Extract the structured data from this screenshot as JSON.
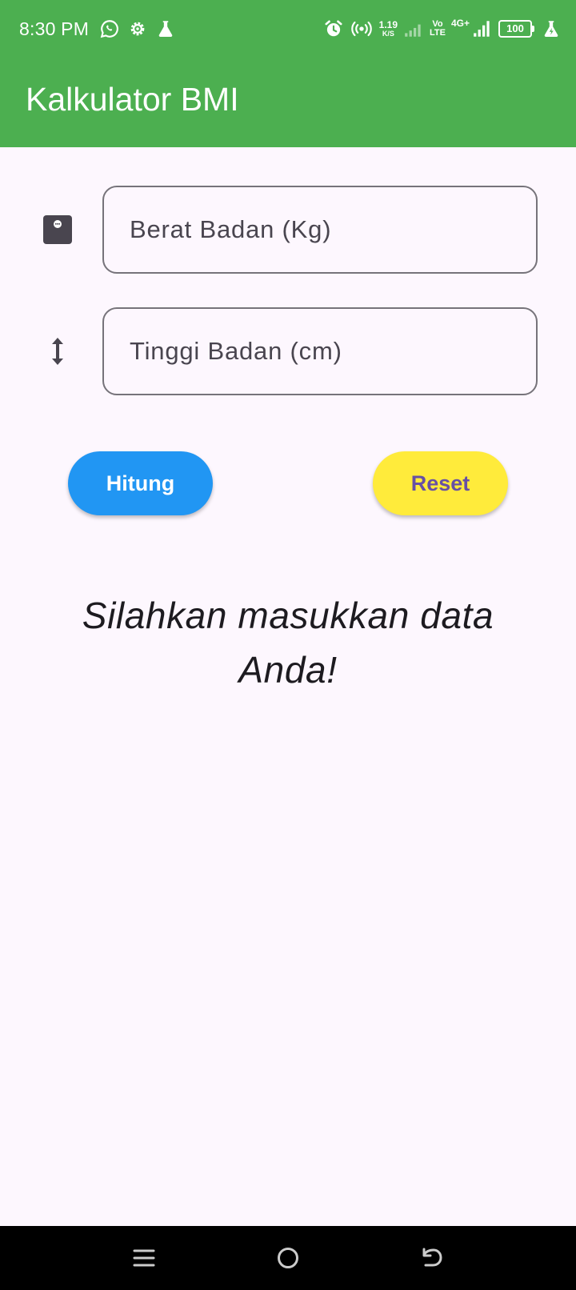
{
  "status_bar": {
    "time": "8:30 PM",
    "left_icons": [
      "whatsapp-icon",
      "settings-gear-icon",
      "flask-icon"
    ],
    "net_speed_value": "1.19",
    "net_speed_unit": "K/S",
    "volte_top": "Vo",
    "volte_bottom": "LTE",
    "network_type": "4G+",
    "battery_level": "100"
  },
  "app_bar": {
    "title": "Kalkulator BMI",
    "background_color": "#4caf50"
  },
  "form": {
    "weight_placeholder": "Berat Badan (Kg)",
    "weight_value": "",
    "weight_icon": "scale-icon",
    "height_placeholder": "Tinggi Badan (cm)",
    "height_value": "",
    "height_icon": "height-arrows-icon"
  },
  "buttons": {
    "calculate_label": "Hitung",
    "calculate_color": "#2196f3",
    "reset_label": "Reset",
    "reset_color": "#ffeb3b"
  },
  "result": {
    "message": "Silahkan masukkan data Anda!"
  },
  "nav_bar": {
    "icons": [
      "menu-icon",
      "home-icon",
      "back-icon"
    ]
  }
}
